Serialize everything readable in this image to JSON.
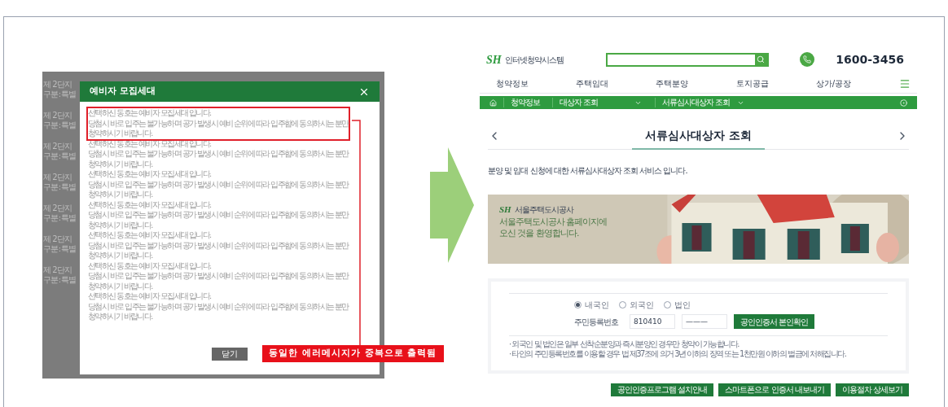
{
  "left_screenshot": {
    "background_rows": [
      {
        "title": "제 2단지",
        "subtitle": "구분 : 특별"
      },
      {
        "title": "제 2단지",
        "subtitle": "구분 : 특별"
      },
      {
        "title": "제 2단지",
        "subtitle": "구분 : 특별"
      },
      {
        "title": "제 2단지",
        "subtitle": "구분 : 특별"
      },
      {
        "title": "제 2단지",
        "subtitle": "구분 : 특별"
      },
      {
        "title": "제 2단지",
        "subtitle": "구분 : 특별"
      },
      {
        "title": "제 2단지",
        "subtitle": "구분 : 특별"
      }
    ],
    "dialog": {
      "title": "예비자 모집세대",
      "messages": [
        {
          "highlighted": true,
          "lines": [
            "선택하신 동호는 예비자 모집세대 입니다.",
            "당첨시 바로 입주는 불가능하며 공가 발생시 예비 순위에 따라 입주함에 동의하시는 분만",
            "청약하시기 바랍니다."
          ]
        },
        {
          "highlighted": false,
          "lines": [
            "선택하신 동호는 예비자 모집세대 입니다.",
            "당첨시 바로 입주는 불가능하며 공가 발생시 예비 순위에 따라 입주함에 동의하시는 분만",
            "청약하시기 바랍니다."
          ]
        },
        {
          "highlighted": false,
          "lines": [
            "선택하신 동호는 예비자 모집세대 입니다.",
            "당첨시 바로 입주는 불가능하며 공가 발생시 예비 순위에 따라 입주함에 동의하시는 분만",
            "청약하시기 바랍니다."
          ]
        },
        {
          "highlighted": false,
          "lines": [
            "선택하신 동호는 예비자 모집세대 입니다.",
            "당첨시 바로 입주는 불가능하며 공가 발생시 예비 순위에 따라 입주함에 동의하시는 분만",
            "청약하시기 바랍니다."
          ]
        },
        {
          "highlighted": false,
          "lines": [
            "선택하신 동호는 예비자 모집세대 입니다.",
            "당첨시 바로 입주는 불가능하며 공가 발생시 예비 순위에 따라 입주함에 동의하시는 분만",
            "청약하시기 바랍니다."
          ]
        },
        {
          "highlighted": false,
          "lines": [
            "선택하신 동호는 예비자 모집세대 입니다.",
            "당첨시 바로 입주는 불가능하며 공가 발생시 예비 순위에 따라 입주함에 동의하시는 분만",
            "청약하시기 바랍니다."
          ]
        },
        {
          "highlighted": false,
          "lines": [
            "선택하신 동호는 예비자 모집세대 입니다.",
            "당첨시 바로 입주는 불가능하며 공가 발생시 예비 순위에 따라 입주함에 동의하시는 분만",
            "청약하시기 바랍니다."
          ]
        }
      ],
      "button": "닫기"
    },
    "annotation": "동일한 에러메시지가 중복으로 출력됨"
  },
  "right_screenshot": {
    "header": {
      "logo_mark": "SH",
      "logo_text": "인터넷청약시스템",
      "phone": "1600-3456"
    },
    "nav": [
      "청약정보",
      "주택임대",
      "주택분양",
      "토지공급",
      "상가/공장"
    ],
    "breadcrumb": [
      {
        "label": "청약정보",
        "dropdown": false
      },
      {
        "label": "대상자 조회",
        "dropdown": true
      },
      {
        "label": "서류심사대상자 조회",
        "dropdown": true
      }
    ],
    "page_title": "서류심사대상자 조회",
    "description": "분양 및 임대 신청에 대한 서류심사대상자 조회 서비스 입니다.",
    "banner": {
      "logo_mark": "SH",
      "logo_text": "서울주택도시공사",
      "welcome": [
        "서울주택도시공사 홈페이지에",
        "오신 것을 환영합니다."
      ]
    },
    "form": {
      "radios": [
        {
          "label": "내국인",
          "selected": true
        },
        {
          "label": "외국인",
          "selected": false
        },
        {
          "label": "법인",
          "selected": false
        }
      ],
      "id_label": "주민등록번호",
      "id_front": "810410",
      "id_back": "———",
      "auth_button": "공인인증서 본인확인",
      "notes": [
        "· 외국인 및 법인은 일부 선착순분양과 즉시분양인 경우만 청약이 가능합니다.",
        "· 타인의 주민등록번호를 이용할 경우 법 제37조에 의거 3년 이하의 징역 또는 1천만원 이하의 벌금에 처해집니다."
      ]
    },
    "buttons": [
      "공인인증프로그램 설치안내",
      "스마트폰으로 인증서 내보내기",
      "이용절차 상세보기"
    ]
  }
}
